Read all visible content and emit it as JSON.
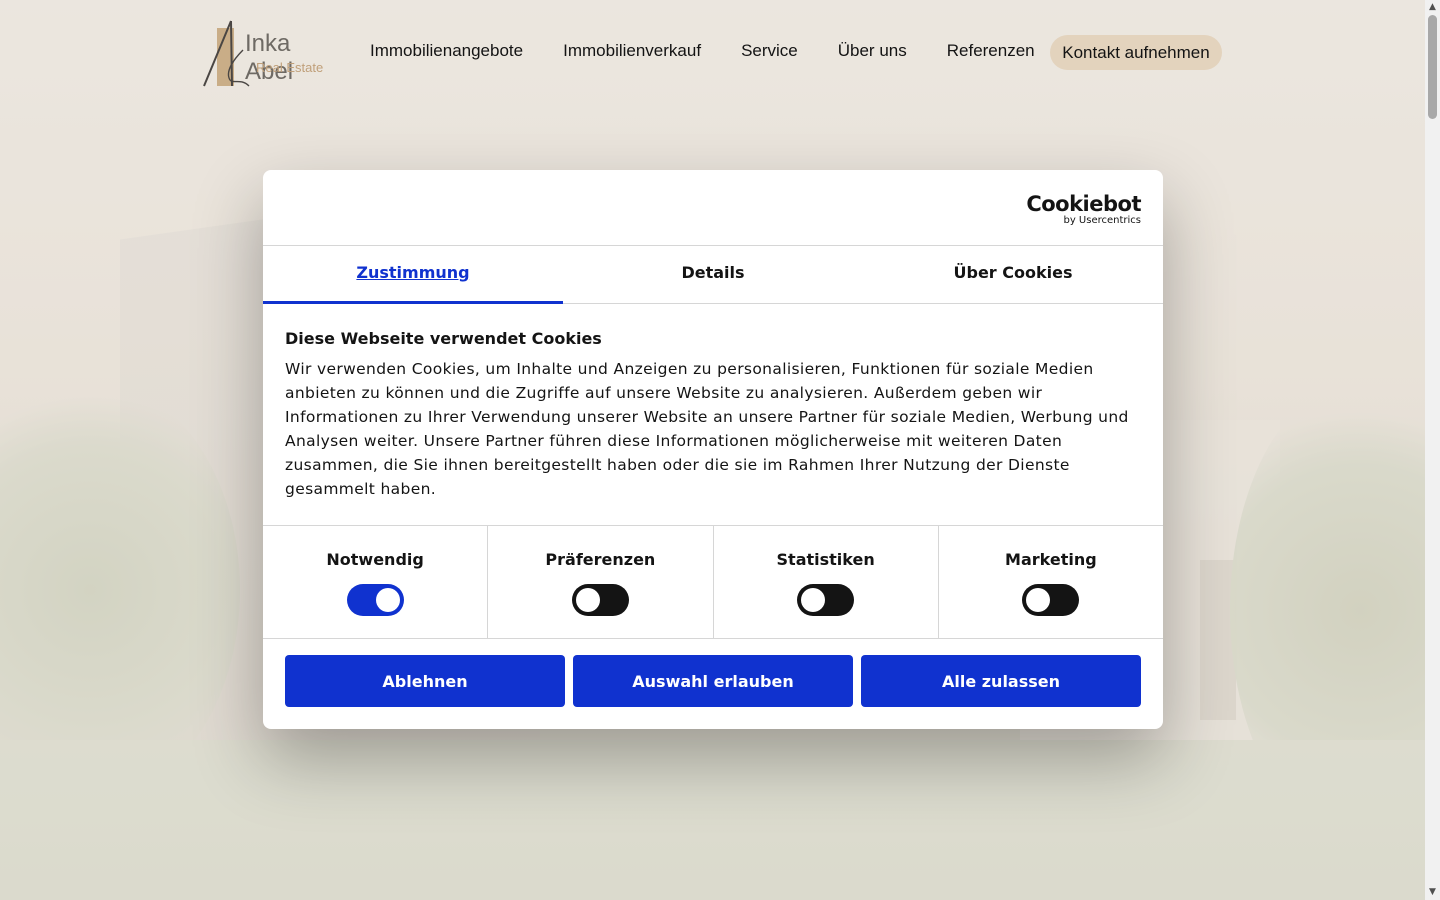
{
  "brand": {
    "name": "Inka Abel",
    "subtitle": "Real Estate"
  },
  "nav": {
    "items": [
      "Immobilienangebote",
      "Immobilienverkauf",
      "Service",
      "Über uns",
      "Referenzen"
    ],
    "contact_label": "Kontakt aufnehmen"
  },
  "cookie_dialog": {
    "provider_name": "Cookiebot",
    "provider_by": "by Usercentrics",
    "tabs": [
      "Zustimmung",
      "Details",
      "Über Cookies"
    ],
    "active_tab": "Zustimmung",
    "heading": "Diese Webseite verwendet Cookies",
    "body": "Wir verwenden Cookies, um Inhalte und Anzeigen zu personalisieren, Funktionen für soziale Medien anbieten zu können und die Zugriffe auf unsere Website zu analysieren. Außerdem geben wir Informationen zu Ihrer Verwendung unserer Website an unsere Partner für soziale Medien, Werbung und Analysen weiter. Unsere Partner führen diese Informationen möglicherweise mit weiteren Daten zusammen, die Sie ihnen bereitgestellt haben oder die sie im Rahmen Ihrer Nutzung der Dienste gesammelt haben.",
    "categories": [
      {
        "label": "Notwendig",
        "enabled": true
      },
      {
        "label": "Präferenzen",
        "enabled": false
      },
      {
        "label": "Statistiken",
        "enabled": false
      },
      {
        "label": "Marketing",
        "enabled": false
      }
    ],
    "buttons": {
      "decline": "Ablehnen",
      "allow_selection": "Auswahl erlauben",
      "allow_all": "Alle zulassen"
    }
  },
  "colors": {
    "accent": "#1032cf",
    "contact_button": "#e3d3bd",
    "logo_gold": "#c0a07a"
  },
  "icons": {
    "logo": "inka-abel-a-logo-icon",
    "scroll_up": "triangle-up-icon",
    "scroll_down": "triangle-down-icon"
  }
}
